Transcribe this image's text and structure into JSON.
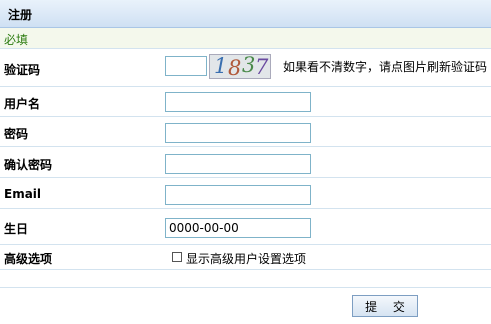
{
  "header": {
    "title": "注册"
  },
  "required_note": "必填",
  "captcha": {
    "label": "验证码",
    "value": "",
    "image_chars": [
      "1",
      "8",
      "3",
      "7"
    ],
    "hint": "如果看不清数字，请点图片刷新验证码"
  },
  "fields": {
    "username": {
      "label": "用户名",
      "value": ""
    },
    "password": {
      "label": "密码",
      "value": ""
    },
    "confirm_password": {
      "label": "确认密码",
      "value": ""
    },
    "email": {
      "label": "Email",
      "value": ""
    },
    "birthday": {
      "label": "生日",
      "value": "0000-00-00"
    }
  },
  "advanced": {
    "label": "高级选项",
    "checkbox_label": "显示高级用户设置选项",
    "checked": false
  },
  "submit_label": "提 交",
  "colors": {
    "header_bg": "#cfe0f3",
    "required_text": "#2e7d12",
    "input_border": "#7fb3c9"
  }
}
